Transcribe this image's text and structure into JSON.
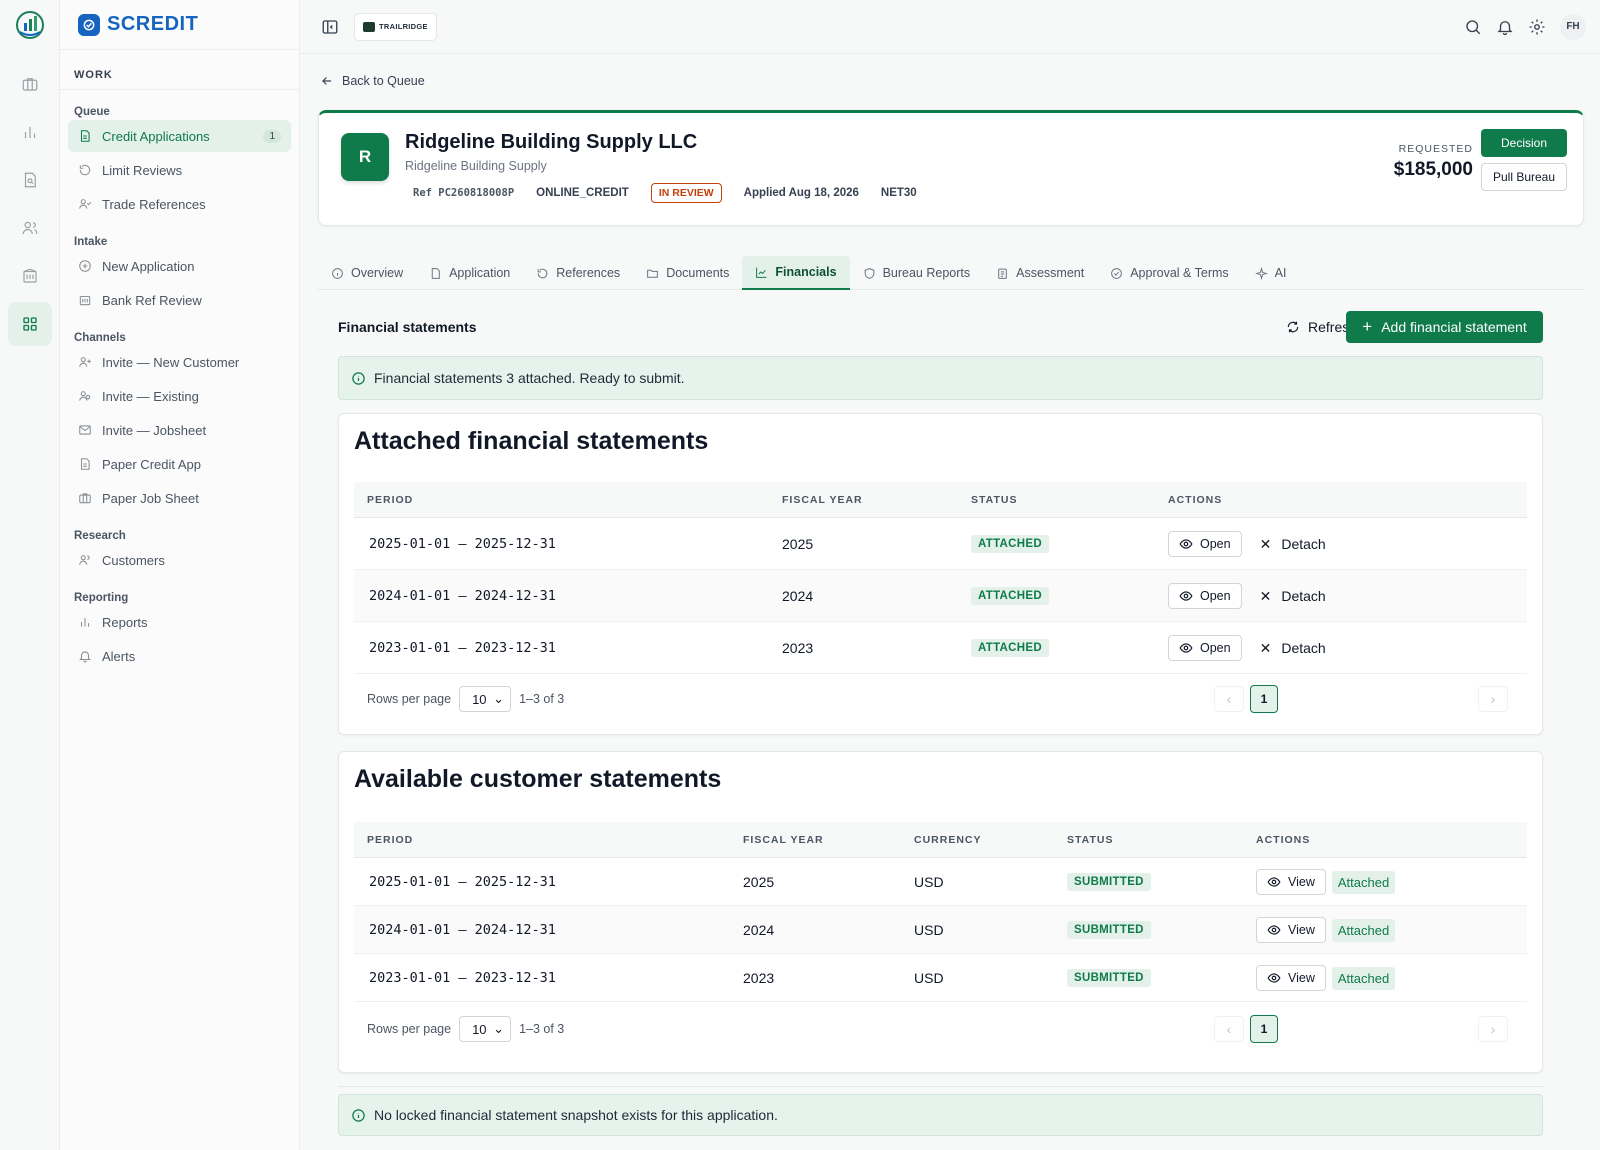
{
  "brand": {
    "name": "SCREDIT"
  },
  "topbar": {
    "org_name": "TRAILRIDGE",
    "avatar_initials": "FH"
  },
  "sidebar": {
    "section": "WORK",
    "groups": [
      {
        "label": "Queue",
        "items": [
          {
            "label": "Credit Applications",
            "count": "1",
            "active": true,
            "icon": "document-icon"
          },
          {
            "label": "Limit Reviews",
            "icon": "refresh-icon"
          },
          {
            "label": "Trade References",
            "icon": "user-check-icon"
          }
        ]
      },
      {
        "label": "Intake",
        "items": [
          {
            "label": "New Application",
            "icon": "plus-circle-icon"
          },
          {
            "label": "Bank Ref Review",
            "icon": "bank-icon"
          }
        ]
      },
      {
        "label": "Channels",
        "items": [
          {
            "label": "Invite — New Customer",
            "icon": "user-plus-icon"
          },
          {
            "label": "Invite — Existing",
            "icon": "users-icon"
          },
          {
            "label": "Invite — Jobsheet",
            "icon": "mail-icon"
          },
          {
            "label": "Paper Credit App",
            "icon": "document-icon"
          },
          {
            "label": "Paper Job Sheet",
            "icon": "briefcase-icon"
          }
        ]
      },
      {
        "label": "Research",
        "items": [
          {
            "label": "Customers",
            "icon": "users-icon"
          }
        ]
      },
      {
        "label": "Reporting",
        "items": [
          {
            "label": "Reports",
            "icon": "bar-chart-icon"
          },
          {
            "label": "Alerts",
            "icon": "bell-icon"
          }
        ]
      }
    ]
  },
  "back_link": "Back to Queue",
  "application": {
    "initial": "R",
    "name": "Ridgeline Building Supply LLC",
    "subname": "Ridgeline Building Supply",
    "ref": "Ref PC260818008P",
    "channel": "ONLINE_CREDIT",
    "status": "IN REVIEW",
    "applied": "Applied Aug 18, 2026",
    "terms": "NET30",
    "requested_label": "REQUESTED",
    "requested_value": "$185,000",
    "decision_label": "Decision",
    "pull_bureau_label": "Pull Bureau"
  },
  "tabs": [
    {
      "label": "Overview",
      "icon": "info-icon"
    },
    {
      "label": "Application",
      "icon": "document-icon"
    },
    {
      "label": "References",
      "icon": "refresh-icon"
    },
    {
      "label": "Documents",
      "icon": "folder-icon"
    },
    {
      "label": "Financials",
      "icon": "line-chart-icon",
      "active": true
    },
    {
      "label": "Bureau Reports",
      "icon": "shield-icon"
    },
    {
      "label": "Assessment",
      "icon": "clipboard-icon"
    },
    {
      "label": "Approval & Terms",
      "icon": "check-circle-icon"
    },
    {
      "label": "AI",
      "icon": "sparkle-icon"
    }
  ],
  "financials": {
    "title": "Financial statements",
    "refresh_label": "Refresh",
    "add_label": "Add financial statement",
    "info_message": "Financial statements 3 attached. Ready to submit.",
    "footer_message": "No locked financial statement snapshot exists for this application."
  },
  "attached": {
    "title": "Attached financial statements",
    "columns": [
      "PERIOD",
      "FISCAL YEAR",
      "STATUS",
      "ACTIONS"
    ],
    "rows": [
      {
        "period": "2025-01-01 – 2025-12-31",
        "fiscal_year": "2025",
        "status": "ATTACHED",
        "open": "Open",
        "detach": "Detach"
      },
      {
        "period": "2024-01-01 – 2024-12-31",
        "fiscal_year": "2024",
        "status": "ATTACHED",
        "open": "Open",
        "detach": "Detach"
      },
      {
        "period": "2023-01-01 – 2023-12-31",
        "fiscal_year": "2023",
        "status": "ATTACHED",
        "open": "Open",
        "detach": "Detach"
      }
    ],
    "pager": {
      "rows_label": "Rows per page",
      "rows_value": "10",
      "range": "1–3 of 3",
      "page": "1"
    }
  },
  "available": {
    "title": "Available customer statements",
    "columns": [
      "PERIOD",
      "FISCAL YEAR",
      "CURRENCY",
      "STATUS",
      "ACTIONS"
    ],
    "rows": [
      {
        "period": "2025-01-01 – 2025-12-31",
        "fiscal_year": "2025",
        "currency": "USD",
        "status": "SUBMITTED",
        "view": "View",
        "tag": "Attached"
      },
      {
        "period": "2024-01-01 – 2024-12-31",
        "fiscal_year": "2024",
        "currency": "USD",
        "status": "SUBMITTED",
        "view": "View",
        "tag": "Attached"
      },
      {
        "period": "2023-01-01 – 2023-12-31",
        "fiscal_year": "2023",
        "currency": "USD",
        "status": "SUBMITTED",
        "view": "View",
        "tag": "Attached"
      }
    ],
    "pager": {
      "rows_label": "Rows per page",
      "rows_value": "10",
      "range": "1–3 of 3",
      "page": "1"
    }
  },
  "colors": {
    "accent": "#0f7a4a",
    "brand": "#1565c0",
    "review": "#c2410c"
  }
}
